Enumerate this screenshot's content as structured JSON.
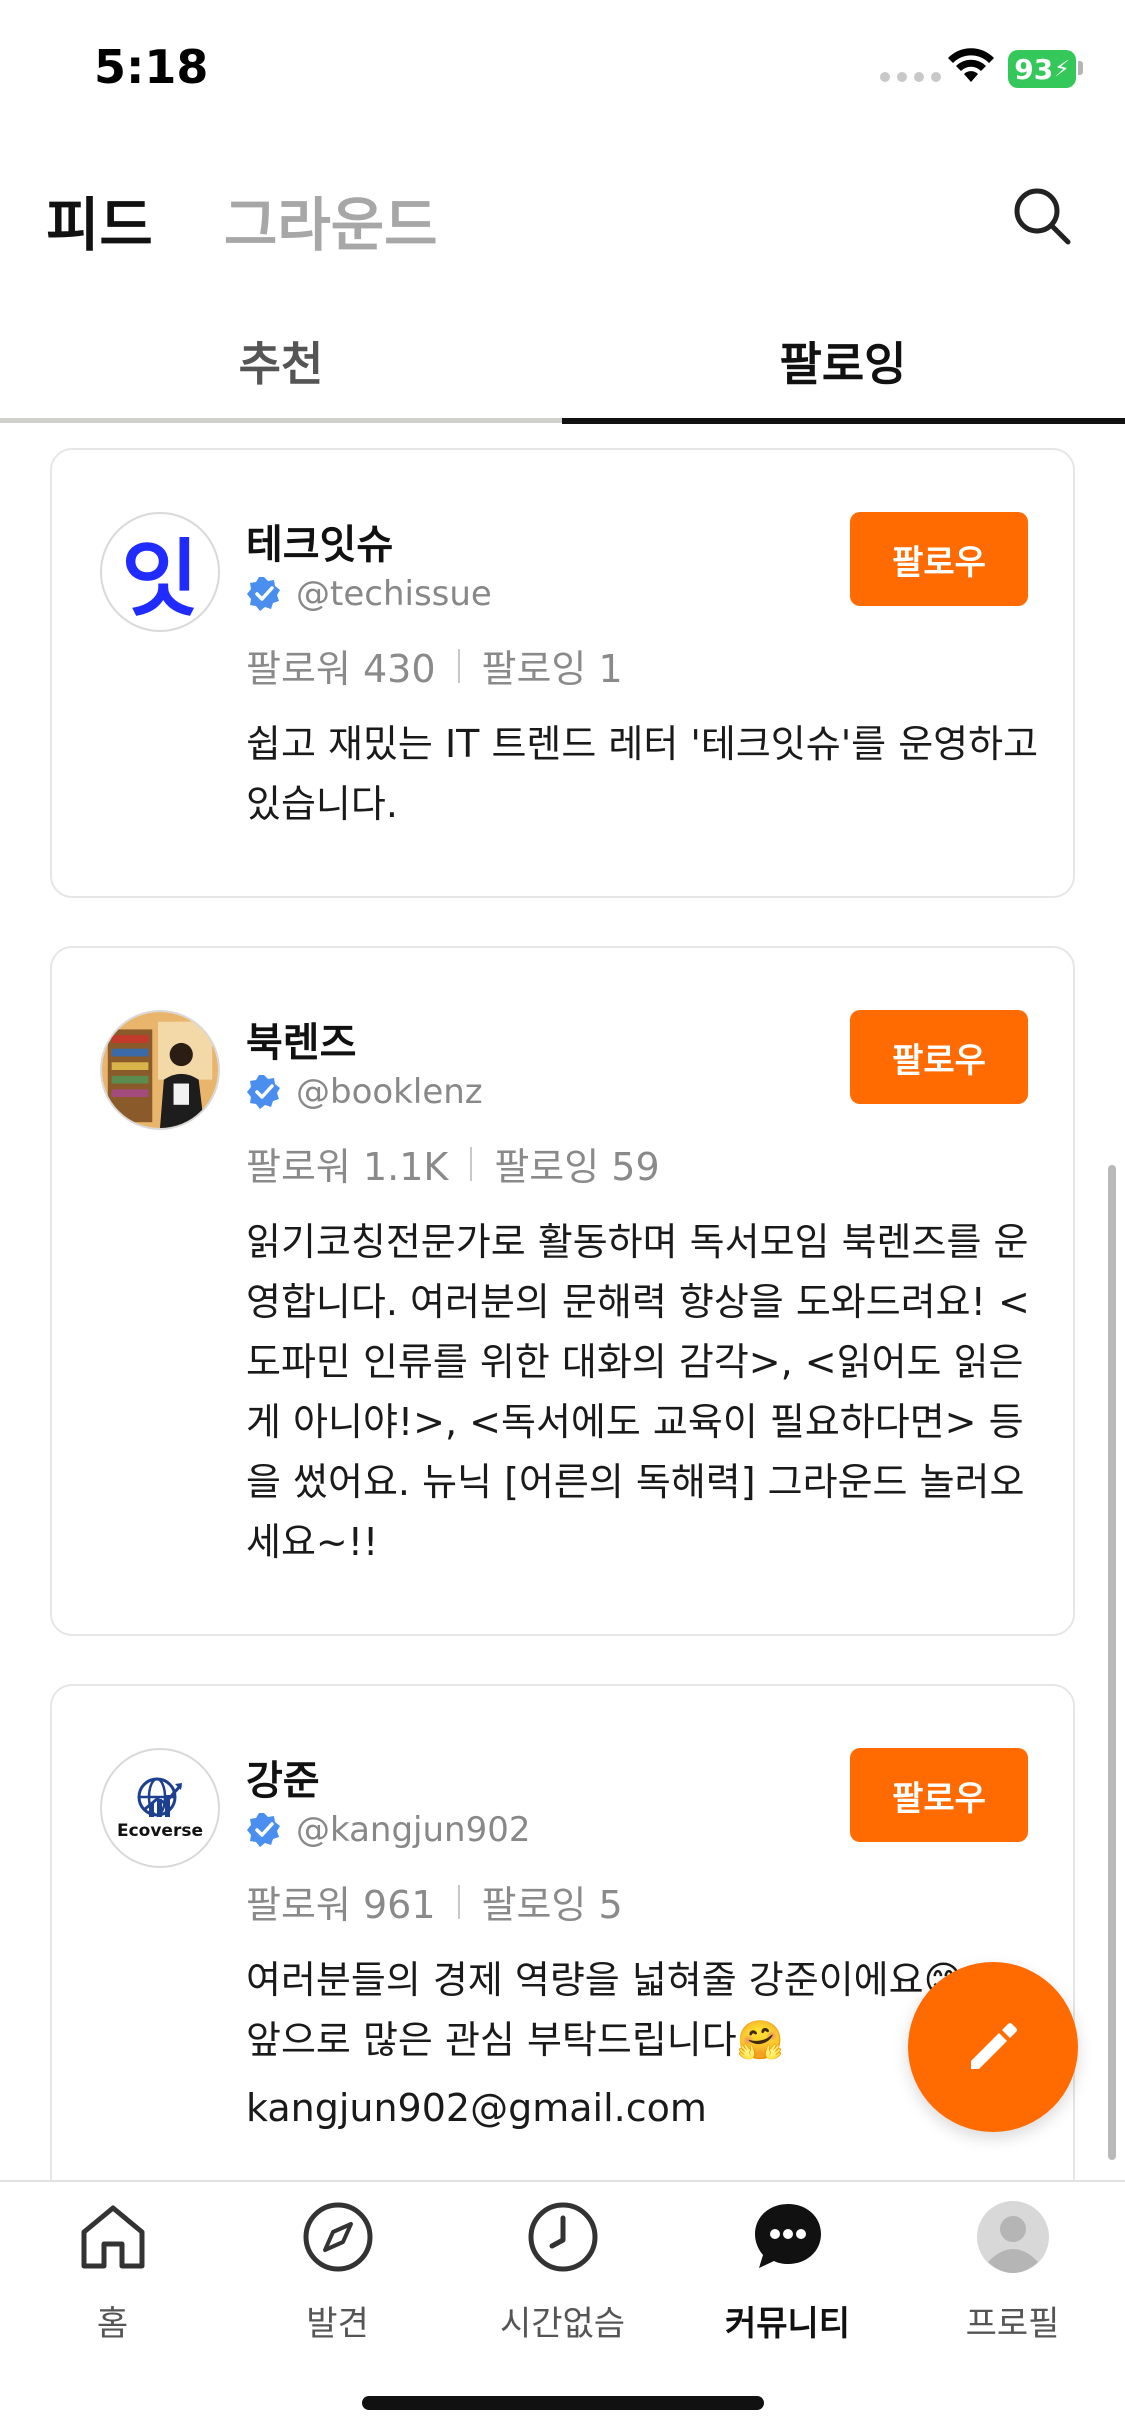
{
  "status_bar": {
    "time": "5:18",
    "battery": "93"
  },
  "header": {
    "feed_label": "피드",
    "ground_label": "그라운드"
  },
  "tabs": [
    {
      "label": "추천"
    },
    {
      "label": "팔로잉"
    }
  ],
  "cards": [
    {
      "name": "테크잇슈",
      "handle": "@techissue",
      "avatar_text": "잇",
      "followers": "팔로워 430",
      "following": "팔로잉 1",
      "bio": "쉽고 재밌는 IT 트렌드 레터 '테크잇슈'를 운영하고 있습니다.",
      "follow_label": "팔로우"
    },
    {
      "name": "북렌즈",
      "handle": "@booklenz",
      "followers": "팔로워 1.1K",
      "following": "팔로잉 59",
      "bio": "읽기코칭전문가로 활동하며 독서모임 북렌즈를 운영합니다. 여러분의 문해력 향상을 도와드려요! <도파민 인류를 위한 대화의 감각>, <읽어도 읽은 게 아니야!>, <독서에도 교육이 필요하다면> 등을 썼어요. 뉴닉 [어른의 독해력] 그라운드 놀러오세요~!!",
      "follow_label": "팔로우"
    },
    {
      "name": "강준",
      "handle": "@kangjun902",
      "avatar_text": "Ecoverse",
      "followers": "팔로워 961",
      "following": "팔로잉 5",
      "bio_line1": "여러분들의 경제 역량을 넓혀줄 강준이에요😊",
      "bio_line2": "앞으로 많은 관심 부탁드립니다🤗",
      "bio_line3": "kangjun902@gmail.com",
      "follow_label": "팔로우"
    }
  ],
  "bottom_nav": [
    {
      "label": "홈",
      "icon": "home-icon"
    },
    {
      "label": "발견",
      "icon": "compass-icon"
    },
    {
      "label": "시간없슴",
      "icon": "clock-icon"
    },
    {
      "label": "커뮤니티",
      "icon": "chat-bubble-icon",
      "active": true
    },
    {
      "label": "프로필",
      "icon": "profile-avatar-icon"
    }
  ],
  "colors": {
    "accent": "#ff6b00",
    "verified": "#4a8ff0",
    "battery": "#34c759"
  }
}
